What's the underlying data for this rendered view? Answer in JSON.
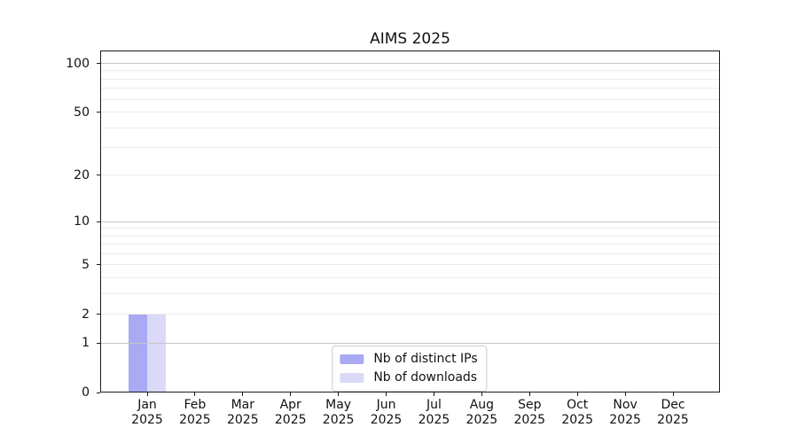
{
  "chart_data": {
    "type": "bar",
    "title": "AIMS 2025",
    "xlabel": "",
    "ylabel": "",
    "categories": [
      "Jan 2025",
      "Feb 2025",
      "Mar 2025",
      "Apr 2025",
      "May 2025",
      "Jun 2025",
      "Jul 2025",
      "Aug 2025",
      "Sep 2025",
      "Oct 2025",
      "Nov 2025",
      "Dec 2025"
    ],
    "series": [
      {
        "name": "Nb of distinct IPs",
        "color": "#a9a9f4",
        "values": [
          2,
          0,
          0,
          0,
          0,
          0,
          0,
          0,
          0,
          0,
          0,
          0
        ]
      },
      {
        "name": "Nb of downloads",
        "color": "#dadaf8",
        "values": [
          2,
          0,
          0,
          0,
          0,
          0,
          0,
          0,
          0,
          0,
          0,
          0
        ]
      }
    ],
    "yscale": "log1p",
    "ylim": [
      0,
      120
    ],
    "yticks": [
      0,
      1,
      2,
      5,
      10,
      20,
      50,
      100
    ],
    "grid_major": [
      1,
      10,
      100
    ],
    "grid_minor": [
      2,
      3,
      4,
      5,
      6,
      7,
      8,
      9,
      20,
      30,
      40,
      50,
      60,
      70,
      80,
      90
    ],
    "grid": "on",
    "legend_position": "lower center"
  },
  "colors": {
    "background": "#ffffff",
    "axis": "#1a1a1a",
    "text": "#111111",
    "grid_minor": "#ececec",
    "grid_major": "#c6c6c6",
    "legend_border": "#cccccc",
    "legend_bg": "#ffffff"
  }
}
